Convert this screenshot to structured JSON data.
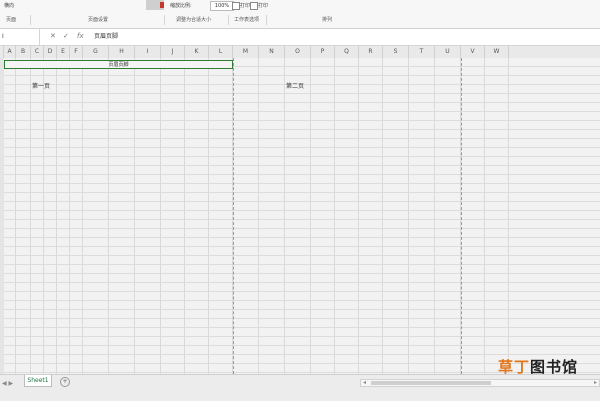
{
  "ribbon": {
    "item_1": "横向",
    "zoom_label": "缩放比例:",
    "zoom_value": "100%",
    "print_label": "打印",
    "print_label_2": "打印"
  },
  "groups": {
    "g1": "页面",
    "g2": "页面设置",
    "g3": "调整为合适大小",
    "g4": "工作表选项",
    "g5": "排列"
  },
  "formula_bar": {
    "name_box": "I",
    "cancel": "✕",
    "enter": "✓",
    "fx": "fx",
    "content": "页眉页脚"
  },
  "columns": [
    "A",
    "B",
    "C",
    "D",
    "E",
    "F",
    "G",
    "H",
    "I",
    "J",
    "K",
    "L",
    "M",
    "N",
    "O",
    "P",
    "Q",
    "R",
    "S",
    "T",
    "U",
    "V",
    "W"
  ],
  "cells": {
    "merged_title": "页眉页脚",
    "page1_label": "第一页",
    "page2_label": "第二页"
  },
  "sheet_tabs": [
    {
      "label": "Sheet1"
    }
  ],
  "add_sheet": "+",
  "watermark": {
    "part_a": "草丁",
    "part_b": "图书馆"
  },
  "colors": {
    "accent_green": "#217346",
    "selection_green": "#2e7d32",
    "watermark_orange": "#e2761a"
  }
}
